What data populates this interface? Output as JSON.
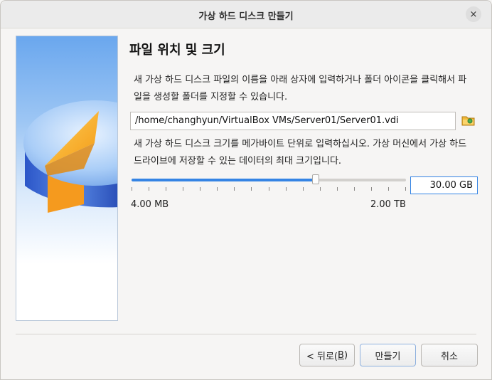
{
  "window": {
    "title": "가상 하드 디스크 만들기",
    "close_icon": "×"
  },
  "heading": "파일 위치 및 크기",
  "location": {
    "description": "새 가상 하드 디스크 파일의 이름을 아래 상자에 입력하거나 폴더 아이콘을 클릭해서 파일을 생성할 폴더를 지정할 수 있습니다.",
    "path_value": "/home/changhyun/VirtualBox VMs/Server01/Server01.vdi",
    "folder_icon": "folder-browse-icon"
  },
  "size": {
    "description": "새 가상 하드 디스크 크기를 메가바이트 단위로 입력하십시오. 가상 머신에서 가상 하드 드라이브에 저장할 수 있는 데이터의 최대 크기입니다.",
    "value": "30.00 GB",
    "slider_fraction": 0.67,
    "min_label": "4.00 MB",
    "max_label": "2.00 TB"
  },
  "buttons": {
    "back_prefix": "< 뒤로(",
    "back_mnemonic": "B",
    "back_suffix": ")",
    "create": "만들기",
    "cancel": "취소"
  },
  "colors": {
    "accent": "#3584e4"
  }
}
